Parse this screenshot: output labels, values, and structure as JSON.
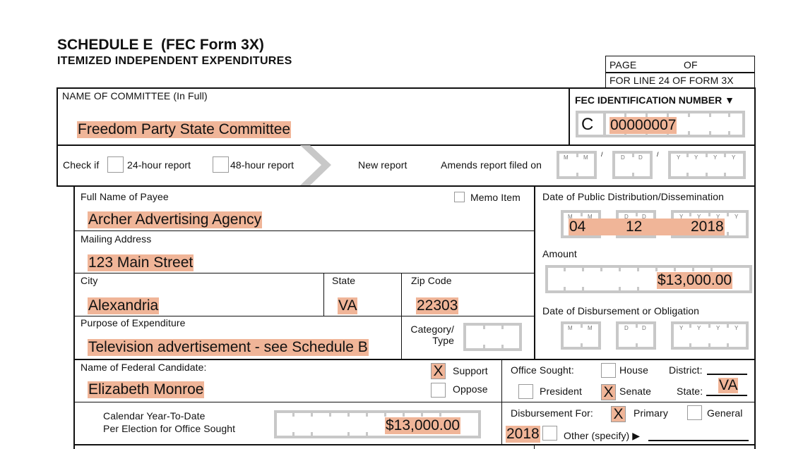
{
  "header": {
    "title": "SCHEDULE E  (FEC Form 3X)",
    "subtitle": "ITEMIZED INDEPENDENT EXPENDITURES",
    "page_label": "PAGE",
    "of_label": "OF",
    "line_label": "FOR LINE 24 OF FORM 3X"
  },
  "committee": {
    "label": "NAME OF COMMITTEE (In Full)",
    "value": "Freedom Party State Committee",
    "fec_id_label": "FEC IDENTIFICATION NUMBER ▼",
    "fec_id_prefix": "C",
    "fec_id_value": "00000007"
  },
  "report_type": {
    "check_if": "Check if",
    "hour24": "24-hour report",
    "hour48": "48-hour report",
    "new_report": "New report",
    "amends": "Amends report filed on",
    "date_placeholders": {
      "m": "M",
      "d": "D",
      "y": "Y",
      "sep": "/"
    }
  },
  "payee": {
    "name_label": "Full Name of Payee",
    "memo_label": "Memo Item",
    "name_value": "Archer Advertising Agency",
    "address_label": "Mailing Address",
    "address_value": "123 Main Street",
    "city_label": "City",
    "city_value": "Alexandria",
    "state_label": "State",
    "state_value": "VA",
    "zip_label": "Zip Code",
    "zip_value": "22303",
    "purpose_label": "Purpose of Expenditure",
    "purpose_value": "Television advertisement - see Schedule B",
    "category_label_1": "Category/",
    "category_label_2": "Type"
  },
  "right_panel": {
    "dissemination_label": "Date of Public Distribution/Dissemination",
    "dissemination_month": "04",
    "dissemination_day": "12",
    "dissemination_year": "2018",
    "amount_label": "Amount",
    "amount_value": "$13,000.00",
    "disbursement_label": "Date of Disbursement or Obligation"
  },
  "candidate": {
    "label": "Name of Federal Candidate:",
    "value": "Elizabeth Monroe",
    "support_label": "Support",
    "support_checked": true,
    "oppose_label": "Oppose",
    "oppose_checked": false,
    "check_mark": "X"
  },
  "office": {
    "label": "Office Sought:",
    "house": "House",
    "house_checked": false,
    "president": "President",
    "president_checked": false,
    "senate": "Senate",
    "senate_checked": true,
    "district_label": "District:",
    "state_label": "State:",
    "state_value": "VA"
  },
  "ytd": {
    "label_1": "Calendar Year-To-Date",
    "label_2": "Per Election for Office Sought",
    "value": "$13,000.00"
  },
  "disbursement_for": {
    "label": "Disbursement For:",
    "primary": "Primary",
    "primary_checked": true,
    "general": "General",
    "general_checked": false,
    "year": "2018",
    "other": "Other (specify) ▶"
  }
}
